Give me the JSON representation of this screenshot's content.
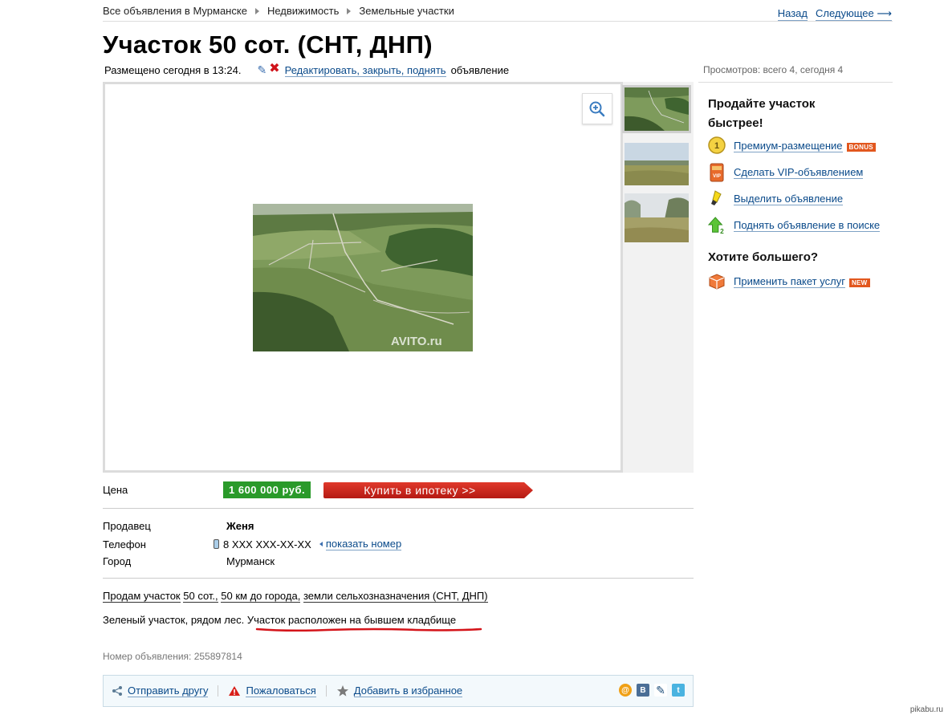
{
  "breadcrumb": [
    "Все объявления в Мурманске",
    "Недвижимость",
    "Земельные участки"
  ],
  "nav": {
    "back": "Назад",
    "next": "Следующее ⟶"
  },
  "title": "Участок 50 сот. (СНТ, ДНП)",
  "meta": {
    "posted": "Размещено сегодня в 13:24.",
    "edit_link": "Редактировать, закрыть, поднять",
    "edit_suffix": "объявление"
  },
  "views": "Просмотров: всего 4, сегодня 4",
  "photo": {
    "watermark": "AVITO.ru",
    "zoom_icon": "zoom-in-icon"
  },
  "price": {
    "label": "Цена",
    "value": "1 600 000 руб.",
    "mortgage": "Купить в ипотеку >>"
  },
  "seller": {
    "label": "Продавец",
    "value": "Женя"
  },
  "phone": {
    "label": "Телефон",
    "value": "8 XXX XXX-XX-XX",
    "show": "показать номер"
  },
  "city": {
    "label": "Город",
    "value": "Мурманск"
  },
  "description": {
    "p1": [
      "Продам участок",
      "50 сот.,",
      "50 км до города,",
      "земли сельхозназначения (СНТ, ДНП)"
    ],
    "p2_plain": "Зеленый участок, рядом лес.",
    "p2_underlined": "Участок расположен на бывшем кладбище"
  },
  "ad_number": "Номер объявления: 255897814",
  "actions": {
    "send": "Отправить другу",
    "report": "Пожаловаться",
    "favorite": "Добавить в избранное"
  },
  "sidebar": {
    "heading1": "Продайте участок быстрее!",
    "items": [
      {
        "label": "Премиум-размещение",
        "badge": "BONUS",
        "icon": "premium-coin-icon"
      },
      {
        "label": "Сделать VIP-объявлением",
        "badge": "",
        "icon": "vip-icon"
      },
      {
        "label": "Выделить объявление",
        "badge": "",
        "icon": "highlighter-icon"
      },
      {
        "label": "Поднять объявление в поиске",
        "badge": "",
        "icon": "arrow-up-icon"
      }
    ],
    "heading2": "Хотите большего?",
    "package": {
      "label": "Применить пакет услуг",
      "badge": "NEW",
      "icon": "package-icon"
    }
  },
  "site_watermark": "pikabu.ru",
  "colors": {
    "price_green": "#2a9a2a",
    "mortgage_red": "#c9221a",
    "link": "#0a4a8a",
    "badge_orange": "#e2571e"
  }
}
